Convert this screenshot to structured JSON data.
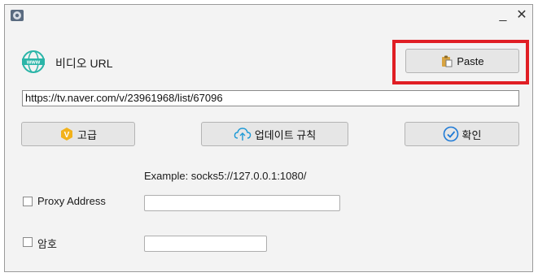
{
  "window": {
    "minimize_symbol": "_",
    "close_symbol": "✕"
  },
  "url_section": {
    "label": "비디오 URL",
    "input_value": "https://tv.naver.com/v/23961968/list/67096",
    "paste_label": "Paste"
  },
  "actions": {
    "advanced_label": "고급",
    "update_label": "업데이트 규칙",
    "confirm_label": "확인"
  },
  "proxy": {
    "example_text": "Example: socks5://127.0.0.1:1080/",
    "proxy_label": "Proxy Address",
    "proxy_checked": false,
    "password_label": "암호",
    "password_checked": false,
    "proxy_value": "",
    "password_value": ""
  },
  "colors": {
    "highlight": "#e01e24",
    "globe": "#2bb5a8",
    "advanced_badge": "#f2b21b",
    "confirm_icon": "#1e7ad6",
    "update_icon": "#1e9ad6"
  },
  "icons": [
    "app-icon",
    "globe-icon",
    "clipboard-icon",
    "v-badge-icon",
    "cloud-upload-icon",
    "check-circle-icon"
  ]
}
